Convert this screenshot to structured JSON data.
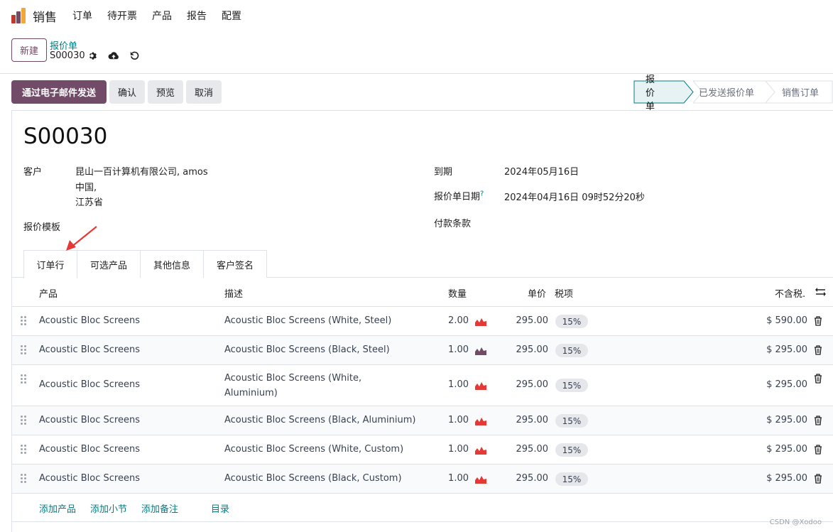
{
  "navbar": {
    "app_name": "销售",
    "menu": [
      "订单",
      "待开票",
      "产品",
      "报告",
      "配置"
    ]
  },
  "control_panel": {
    "new_label": "新建",
    "breadcrumb": "报价单",
    "record": "S00030"
  },
  "actions": {
    "send_email": "通过电子邮件发送",
    "confirm": "确认",
    "preview": "预览",
    "cancel": "取消"
  },
  "statusbar": [
    "报价单",
    "已发送报价单",
    "销售订单"
  ],
  "form": {
    "title": "S00030",
    "customer_label": "客户",
    "customer_line1": "昆山一百计算机有限公司, amos",
    "customer_line2": "中国,",
    "customer_line3": "江苏省",
    "template_label": "报价模板",
    "expiry_label": "到期",
    "expiry_value": "2024年05月16日",
    "quote_date_label": "报价单日期",
    "quote_date_help": "?",
    "quote_date_value": "2024年04月16日 09时52分20秒",
    "payment_terms_label": "付款条款"
  },
  "tabs": [
    "订单行",
    "可选产品",
    "其他信息",
    "客户签名"
  ],
  "table": {
    "headers": {
      "product": "产品",
      "description": "描述",
      "quantity": "数量",
      "unit_price": "单价",
      "taxes": "税项",
      "subtotal": "不含税."
    },
    "rows": [
      {
        "product": "Acoustic Bloc Screens",
        "description": "Acoustic Bloc Screens (White, Steel)",
        "desc2": "",
        "qty": "2.00",
        "price": "295.00",
        "tax": "15%",
        "subtotal": "$ 590.00"
      },
      {
        "product": "Acoustic Bloc Screens",
        "description": "Acoustic Bloc Screens (Black, Steel)",
        "desc2": "",
        "qty": "1.00",
        "price": "295.00",
        "tax": "15%",
        "subtotal": "$ 295.00"
      },
      {
        "product": "Acoustic Bloc Screens",
        "description": "Acoustic Bloc Screens (White,",
        "desc2": "Aluminium)",
        "qty": "1.00",
        "price": "295.00",
        "tax": "15%",
        "subtotal": "$ 295.00"
      },
      {
        "product": "Acoustic Bloc Screens",
        "description": "Acoustic Bloc Screens (Black, Aluminium)",
        "desc2": "",
        "qty": "1.00",
        "price": "295.00",
        "tax": "15%",
        "subtotal": "$ 295.00"
      },
      {
        "product": "Acoustic Bloc Screens",
        "description": "Acoustic Bloc Screens (White, Custom)",
        "desc2": "",
        "qty": "1.00",
        "price": "295.00",
        "tax": "15%",
        "subtotal": "$ 295.00"
      },
      {
        "product": "Acoustic Bloc Screens",
        "description": "Acoustic Bloc Screens (Black, Custom)",
        "desc2": "",
        "qty": "1.00",
        "price": "295.00",
        "tax": "15%",
        "subtotal": "$ 295.00"
      }
    ]
  },
  "add_links": {
    "add_product": "添加产品",
    "add_section": "添加小节",
    "add_note": "添加备注",
    "catalog": "目录"
  },
  "watermark": "CSDN @Xodoo",
  "colors": {
    "primary": "#714b67",
    "link": "#017e84",
    "alert_red": "#e53935"
  }
}
